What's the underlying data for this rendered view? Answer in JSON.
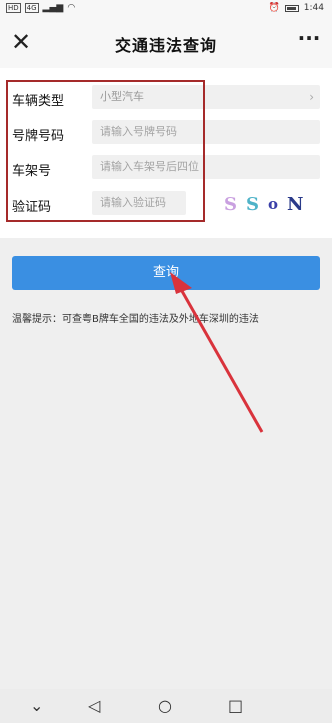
{
  "status_bar": {
    "left_chips": [
      "HD",
      "4G"
    ],
    "time": "1:44",
    "alarm_icon": "alarm-icon",
    "battery_icon": "battery-icon"
  },
  "header": {
    "title": "交通违法查询",
    "close_icon": "close-icon",
    "more_icon": "more-icon"
  },
  "form": {
    "vehicle_type": {
      "label": "车辆类型",
      "value": "小型汽车"
    },
    "plate": {
      "label": "号牌号码",
      "placeholder": "请输入号牌号码"
    },
    "vin": {
      "label": "车架号",
      "placeholder": "请输入车架号后四位"
    },
    "captcha": {
      "label": "验证码",
      "placeholder": "请输入验证码",
      "chars": [
        "S",
        "S",
        "o",
        "N"
      ]
    }
  },
  "query_button": {
    "label": "查询"
  },
  "tip": "温馨提示：可查粤B牌车全国的违法及外地车深圳的违法",
  "annotation": {
    "box_color": "#a52a2a",
    "arrow_color": "#d9333c"
  },
  "nav": [
    "back-icon",
    "home-icon",
    "recents-icon",
    "down-icon"
  ],
  "colors": {
    "accent": "#3a8fe2"
  }
}
